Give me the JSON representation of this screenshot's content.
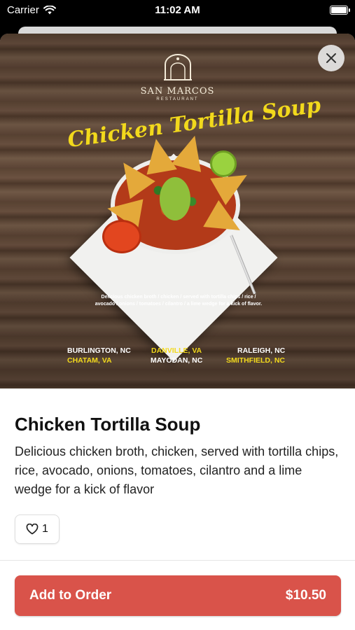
{
  "status_bar": {
    "carrier": "Carrier",
    "time": "11:02 AM"
  },
  "hero": {
    "logo_name": "SAN MARCOS",
    "logo_sub": "RESTAURANT",
    "script_title": "Chicken Tortilla Soup",
    "caption_line1": "Delicious chicken broth / chicken / served with tortilla chips / rice /",
    "caption_line2": "avocado / onions / tomatoes / cilantro / a lime wedge for a kick of flavor.",
    "locations": [
      {
        "label": "BURLINGTON, NC",
        "color": "white"
      },
      {
        "label": "DANVILLE, VA",
        "color": "yellow"
      },
      {
        "label": "RALEIGH, NC",
        "color": "white"
      },
      {
        "label": "CHATAM, VA",
        "color": "yellow"
      },
      {
        "label": "MAYODAN, NC",
        "color": "white"
      },
      {
        "label": "SMITHFIELD, NC",
        "color": "yellow"
      }
    ]
  },
  "item": {
    "title": "Chicken Tortilla Soup",
    "description": "Delicious chicken broth, chicken, served with tortilla chips, rice, avocado, onions, tomatoes, cilantro and a lime wedge for a kick of flavor",
    "like_count": "1"
  },
  "order_button": {
    "label": "Add to Order",
    "price": "$10.50"
  },
  "colors": {
    "accent": "#d9534a",
    "script_yellow": "#f2d91c"
  }
}
